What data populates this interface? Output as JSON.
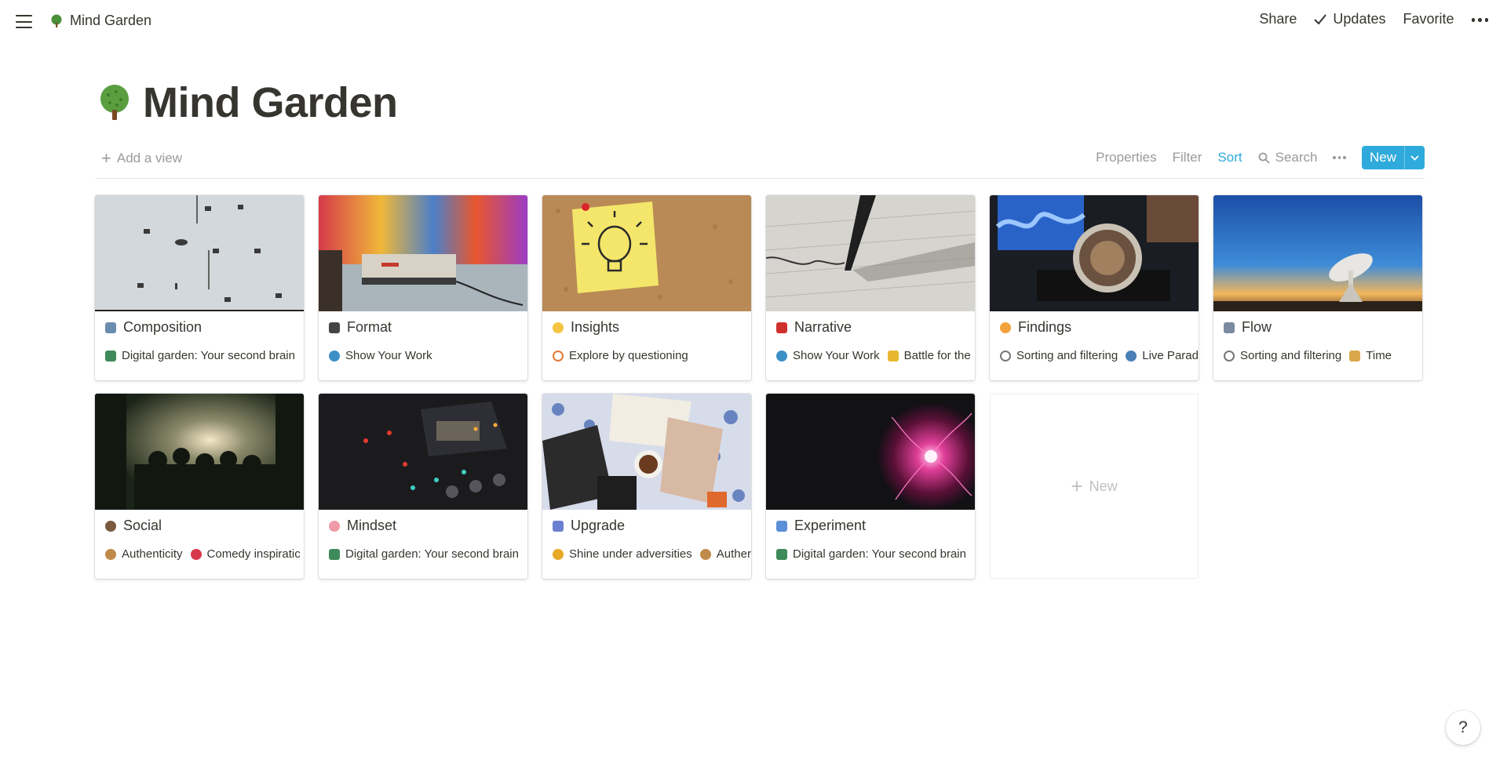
{
  "topbar": {
    "breadcrumb": "Mind Garden",
    "share": "Share",
    "updates": "Updates",
    "favorite": "Favorite"
  },
  "page": {
    "title": "Mind Garden",
    "icon": "tree-icon"
  },
  "viewbar": {
    "add_view": "Add a view",
    "properties": "Properties",
    "filter": "Filter",
    "sort": "Sort",
    "search": "Search",
    "new": "New"
  },
  "colors": {
    "accent": "#2eaadc",
    "text": "#37352f",
    "muted": "#9b9a97"
  },
  "cards": [
    {
      "title": "Composition",
      "icon": "framed-picture-icon",
      "cover": "white-table-pieces",
      "tags": [
        {
          "label": "Digital garden: Your second brain",
          "icon": "landscape-icon"
        }
      ]
    },
    {
      "title": "Format",
      "icon": "videocassette-icon",
      "cover": "retro-console-paint",
      "tags": [
        {
          "label": "Show Your Work",
          "icon": "globe-icon"
        }
      ]
    },
    {
      "title": "Insights",
      "icon": "light-bulb-icon",
      "cover": "lightbulb-sticky-note",
      "tags": [
        {
          "label": "Explore by questioning",
          "icon": "no-entry-icon"
        }
      ]
    },
    {
      "title": "Narrative",
      "icon": "red-book-icon",
      "cover": "fountain-pen-writing",
      "tags": [
        {
          "label": "Show Your Work",
          "icon": "globe-icon"
        },
        {
          "label": "Battle for the",
          "icon": "trophy-icon"
        }
      ]
    },
    {
      "title": "Findings",
      "icon": "exploding-head-icon",
      "cover": "headphones-studio",
      "tags": [
        {
          "label": "Sorting and filtering",
          "icon": "gear-icon"
        },
        {
          "label": "Live Parad",
          "icon": "headphones-icon"
        }
      ]
    },
    {
      "title": "Flow",
      "icon": "telescope-icon",
      "cover": "radio-telescope-sunset",
      "tags": [
        {
          "label": "Sorting and filtering",
          "icon": "gear-icon"
        },
        {
          "label": "Time",
          "icon": "hourglass-icon"
        }
      ]
    },
    {
      "title": "Social",
      "icon": "person-icon",
      "cover": "crowd-forest-sunset",
      "tags": [
        {
          "label": "Authenticity",
          "icon": "person-icon"
        },
        {
          "label": "Comedy inspiratic",
          "icon": "lips-icon"
        }
      ]
    },
    {
      "title": "Mindset",
      "icon": "brain-icon",
      "cover": "mixing-console",
      "tags": [
        {
          "label": "Digital garden: Your second brain",
          "icon": "landscape-icon"
        }
      ]
    },
    {
      "title": "Upgrade",
      "icon": "dna-icon",
      "cover": "books-coffee-table",
      "tags": [
        {
          "label": "Shine under adversities",
          "icon": "medal-icon"
        },
        {
          "label": "Auther",
          "icon": "person-icon"
        }
      ]
    },
    {
      "title": "Experiment",
      "icon": "chair-icon",
      "cover": "plasma-ball",
      "tags": [
        {
          "label": "Digital garden: Your second brain",
          "icon": "landscape-icon"
        }
      ]
    }
  ],
  "new_card_label": "New",
  "help": "?"
}
